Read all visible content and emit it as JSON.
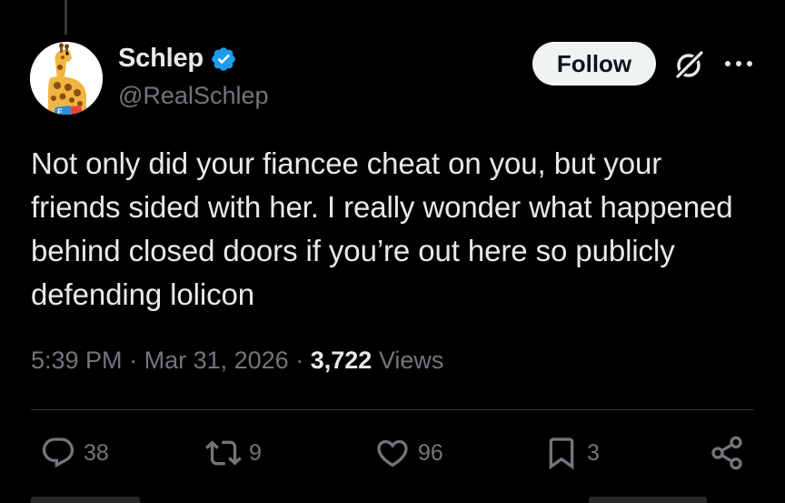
{
  "author": {
    "display_name": "Schlep",
    "handle": "@RealSchlep",
    "verified": true,
    "avatar_icon": "giraffe-avatar"
  },
  "header": {
    "follow_label": "Follow",
    "grok_icon": "grok-icon",
    "more_icon": "more-icon"
  },
  "tweet": {
    "text": "Not only did your fiancee cheat on you, but your friends sided with her. I really wonder what happened behind closed doors if you’re out here so publicly defending lolicon",
    "time": "5:39 PM",
    "separator": "·",
    "date": "Mar 31, 2026",
    "views_count": "3,722",
    "views_label": "Views"
  },
  "actions": {
    "replies": "38",
    "reposts": "9",
    "likes": "96",
    "bookmarks": "3"
  },
  "colors": {
    "background": "#000000",
    "text": "#e7e9ea",
    "muted": "#71767b",
    "verified": "#1d9bf0"
  }
}
